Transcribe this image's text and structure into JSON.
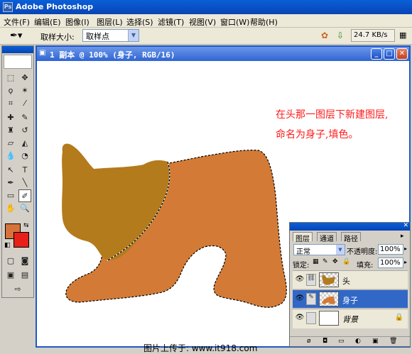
{
  "app": {
    "title": "Adobe Photoshop"
  },
  "menu": {
    "items": [
      "文件(F)",
      "编辑(E)",
      "图像(I)",
      "图层(L)",
      "选择(S)",
      "滤镜(T)",
      "视图(V)",
      "窗口(W)",
      "帮助(H)"
    ]
  },
  "options": {
    "sample_size_label": "取样大小:",
    "sample_size_value": "取样点",
    "speed": "24.7 KB/s"
  },
  "document": {
    "title": "1 副本 @ 100% (身子, RGB/16)",
    "annotation": "在头那一图层下新建图层,\n命名为身子,填色。",
    "watermark": "图片上传于: www.it918.com"
  },
  "layers_panel": {
    "tabs": [
      "图层",
      "通道",
      "路径"
    ],
    "blend_mode": "正常",
    "opacity_label": "不透明度:",
    "opacity_value": "100%",
    "lock_label": "锁定:",
    "fill_label": "填充:",
    "fill_value": "100%",
    "layers": [
      {
        "name": "头",
        "selected": false
      },
      {
        "name": "身子",
        "selected": true
      },
      {
        "name": "背景",
        "selected": false
      }
    ]
  },
  "colors": {
    "foreground": "#d6733a",
    "background": "#e8201a",
    "head_fill": "#b37b1c",
    "body_fill": "#d37b36"
  }
}
